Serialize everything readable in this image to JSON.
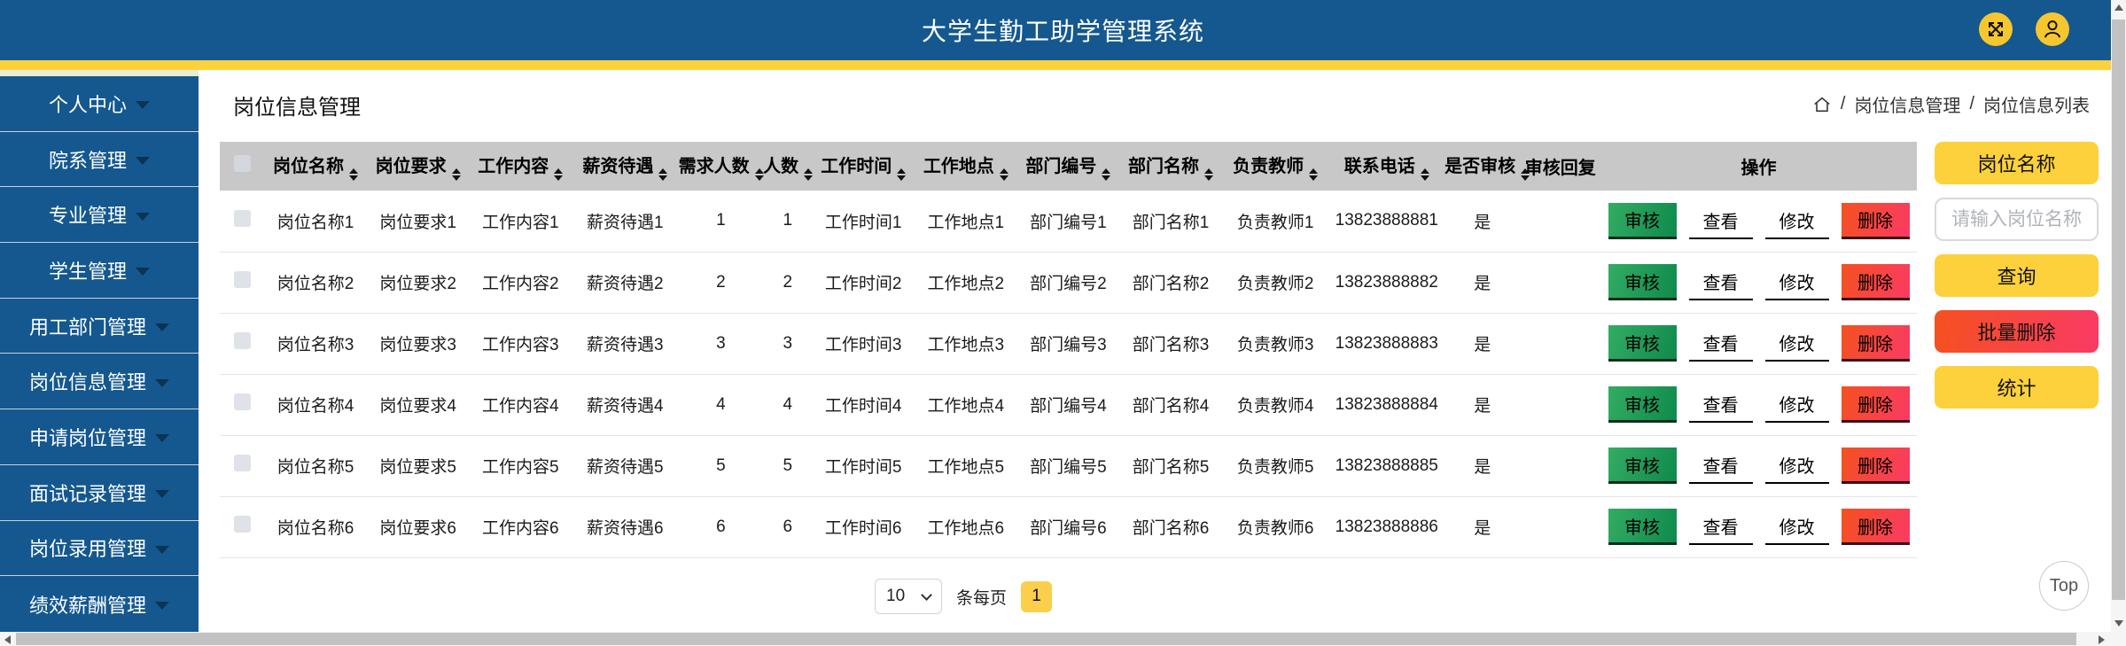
{
  "header": {
    "title": "大学生勤工助学管理系统"
  },
  "sidebar": {
    "items": [
      {
        "id": "personal-center",
        "label": "个人中心"
      },
      {
        "id": "faculty-mgmt",
        "label": "院系管理"
      },
      {
        "id": "major-mgmt",
        "label": "专业管理"
      },
      {
        "id": "student-mgmt",
        "label": "学生管理"
      },
      {
        "id": "employer-dept-mgmt",
        "label": "用工部门管理"
      },
      {
        "id": "job-info-mgmt",
        "label": "岗位信息管理"
      },
      {
        "id": "job-application-mgmt",
        "label": "申请岗位管理"
      },
      {
        "id": "interview-record-mgmt",
        "label": "面试记录管理"
      },
      {
        "id": "job-hiring-mgmt",
        "label": "岗位录用管理"
      },
      {
        "id": "performance-pay-mgmt",
        "label": "绩效薪酬管理"
      }
    ]
  },
  "main": {
    "page_title": "岗位信息管理",
    "breadcrumb": {
      "separator": "/",
      "items": [
        "岗位信息管理",
        "岗位信息列表"
      ]
    },
    "table": {
      "columns": [
        {
          "key": "name",
          "label": "岗位名称",
          "sortable": true
        },
        {
          "key": "requirement",
          "label": "岗位要求",
          "sortable": true
        },
        {
          "key": "content",
          "label": "工作内容",
          "sortable": true
        },
        {
          "key": "salary",
          "label": "薪资待遇",
          "sortable": true
        },
        {
          "key": "demand",
          "label": "需求人数",
          "sortable": true
        },
        {
          "key": "headcount",
          "label": "人数",
          "sortable": true
        },
        {
          "key": "time",
          "label": "工作时间",
          "sortable": true
        },
        {
          "key": "location",
          "label": "工作地点",
          "sortable": true
        },
        {
          "key": "dept_no",
          "label": "部门编号",
          "sortable": true
        },
        {
          "key": "dept_name",
          "label": "部门名称",
          "sortable": true
        },
        {
          "key": "teacher",
          "label": "负责教师",
          "sortable": true
        },
        {
          "key": "phone",
          "label": "联系电话",
          "sortable": true
        },
        {
          "key": "audited",
          "label": "是否审核",
          "sortable": true
        },
        {
          "key": "reply",
          "label": "审核回复",
          "sortable": false
        },
        {
          "key": "actions",
          "label": "操作",
          "sortable": false
        }
      ],
      "action_labels": {
        "audit": "审核",
        "view": "查看",
        "edit": "修改",
        "delete": "删除"
      },
      "rows": [
        {
          "name": "岗位名称1",
          "requirement": "岗位要求1",
          "content": "工作内容1",
          "salary": "薪资待遇1",
          "demand": "1",
          "headcount": "1",
          "time": "工作时间1",
          "location": "工作地点1",
          "dept_no": "部门编号1",
          "dept_name": "部门名称1",
          "teacher": "负责教师1",
          "phone": "13823888881",
          "audited": "是",
          "reply": ""
        },
        {
          "name": "岗位名称2",
          "requirement": "岗位要求2",
          "content": "工作内容2",
          "salary": "薪资待遇2",
          "demand": "2",
          "headcount": "2",
          "time": "工作时间2",
          "location": "工作地点2",
          "dept_no": "部门编号2",
          "dept_name": "部门名称2",
          "teacher": "负责教师2",
          "phone": "13823888882",
          "audited": "是",
          "reply": ""
        },
        {
          "name": "岗位名称3",
          "requirement": "岗位要求3",
          "content": "工作内容3",
          "salary": "薪资待遇3",
          "demand": "3",
          "headcount": "3",
          "time": "工作时间3",
          "location": "工作地点3",
          "dept_no": "部门编号3",
          "dept_name": "部门名称3",
          "teacher": "负责教师3",
          "phone": "13823888883",
          "audited": "是",
          "reply": ""
        },
        {
          "name": "岗位名称4",
          "requirement": "岗位要求4",
          "content": "工作内容4",
          "salary": "薪资待遇4",
          "demand": "4",
          "headcount": "4",
          "time": "工作时间4",
          "location": "工作地点4",
          "dept_no": "部门编号4",
          "dept_name": "部门名称4",
          "teacher": "负责教师4",
          "phone": "13823888884",
          "audited": "是",
          "reply": ""
        },
        {
          "name": "岗位名称5",
          "requirement": "岗位要求5",
          "content": "工作内容5",
          "salary": "薪资待遇5",
          "demand": "5",
          "headcount": "5",
          "time": "工作时间5",
          "location": "工作地点5",
          "dept_no": "部门编号5",
          "dept_name": "部门名称5",
          "teacher": "负责教师5",
          "phone": "13823888885",
          "audited": "是",
          "reply": ""
        },
        {
          "name": "岗位名称6",
          "requirement": "岗位要求6",
          "content": "工作内容6",
          "salary": "薪资待遇6",
          "demand": "6",
          "headcount": "6",
          "time": "工作时间6",
          "location": "工作地点6",
          "dept_no": "部门编号6",
          "dept_name": "部门名称6",
          "teacher": "负责教师6",
          "phone": "13823888886",
          "audited": "是",
          "reply": ""
        }
      ]
    },
    "pagination": {
      "page_size": "10",
      "per_page_label": "条每页",
      "current_page": "1"
    },
    "top_button_label": "Top"
  },
  "side_panel": {
    "title_button": "岗位名称",
    "input_placeholder": "请输入岗位名称",
    "query_button": "查询",
    "batch_delete_button": "批量删除",
    "stats_button": "统计"
  },
  "colors": {
    "primary": "#14588f",
    "topbar_yellow": "#fdd13c",
    "pale_strip": "#e9eed3",
    "icon_yellow": "#f6c62f",
    "table_header_bg": "#c8c8c8",
    "button_yellow": "#fcd13b",
    "page_button_yellow": "#fbcf4b",
    "green_from": "#33ac63",
    "green_to": "#0f8a4c",
    "red_from": "#f4511f",
    "red_to": "#fa3a65"
  }
}
